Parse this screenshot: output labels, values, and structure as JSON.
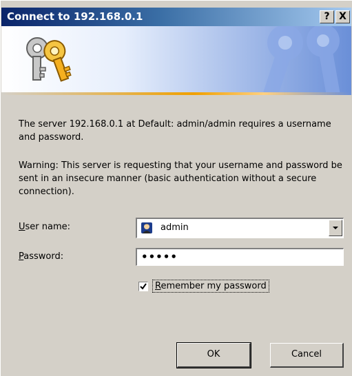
{
  "window": {
    "title": "Connect to 192.168.0.1",
    "help_label": "?",
    "close_label": "X"
  },
  "banner": {
    "icon": "keys-icon",
    "watermark_icon": "keys-watermark-icon"
  },
  "message": {
    "line1": "The server 192.168.0.1 at Default: admin/admin requires a username and password.",
    "warning": "Warning: This server is requesting that your username and password be sent in an insecure manner (basic authentication without a secure connection)."
  },
  "form": {
    "username_label_accel": "U",
    "username_label_rest": "ser name:",
    "username_value": "admin",
    "username_icon": "user-icon",
    "password_label_accel": "P",
    "password_label_rest": "assword:",
    "password_value": "•••••",
    "remember_accel": "R",
    "remember_rest": "emember my password",
    "remember_checked": true
  },
  "buttons": {
    "ok": "OK",
    "cancel": "Cancel"
  },
  "colors": {
    "title_start": "#0a246a",
    "title_end": "#a6caf0",
    "face": "#d4d0c8",
    "accent_line": "#f0a000"
  }
}
